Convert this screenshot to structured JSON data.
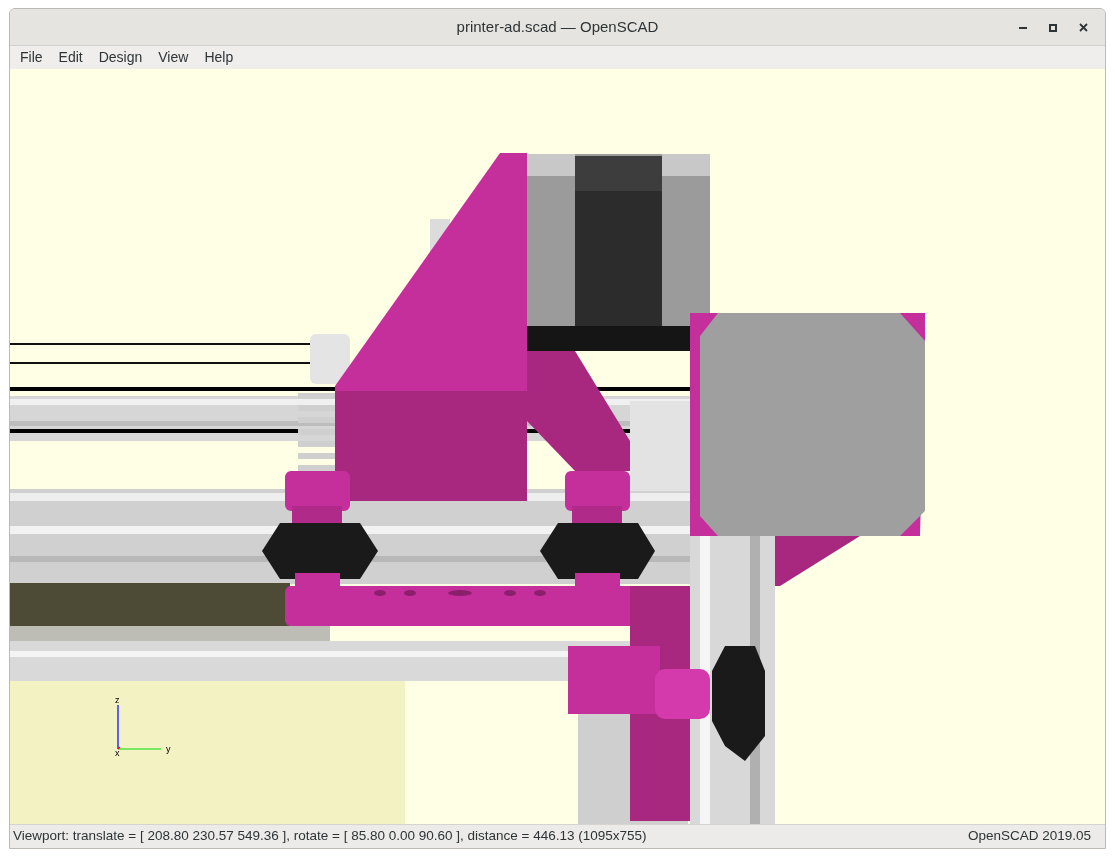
{
  "window": {
    "title": "printer-ad.scad — OpenSCAD"
  },
  "menu": [
    "File",
    "Edit",
    "Design",
    "View",
    "Help"
  ],
  "viewport": {
    "axes": {
      "z": "z",
      "x": "x",
      "y": "y"
    }
  },
  "status_bar": {
    "viewport_info": "Viewport: translate = [ 208.80 230.57 549.36 ], rotate = [ 85.80 0.00 90.60 ], distance = 446.13 (1095x755)",
    "version": "OpenSCAD 2019.05"
  }
}
